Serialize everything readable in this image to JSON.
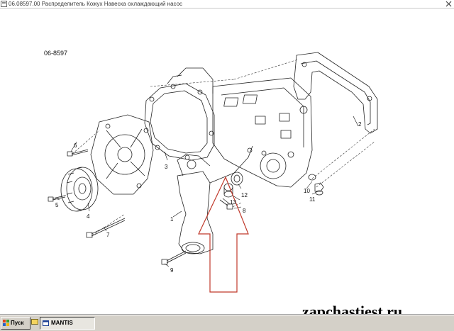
{
  "window": {
    "title": "06.08597.00 Распределитель Кожух Навеска охлаждающий насос"
  },
  "diagram": {
    "code": "06-8597",
    "callouts": [
      "1",
      "2",
      "3",
      "4",
      "5",
      "6",
      "7",
      "8",
      "9",
      "10",
      "11",
      "12",
      "13"
    ]
  },
  "watermark": "zapchastiest.ru",
  "taskbar": {
    "start_label": "Пуск",
    "task_label": "MANTIS"
  },
  "colors": {
    "line": "#111111",
    "arrow": "#c0392b",
    "taskbar": "#d4d0c8"
  }
}
